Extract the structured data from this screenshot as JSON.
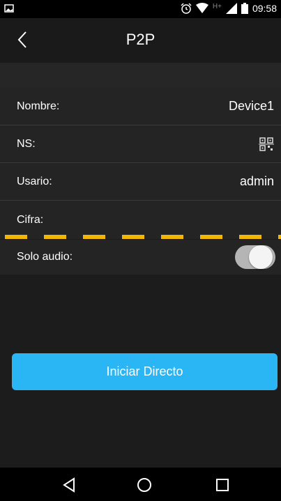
{
  "status": {
    "time": "09:58",
    "network": "H+"
  },
  "header": {
    "title": "P2P"
  },
  "form": {
    "name_label": "Nombre:",
    "name_value": "Device1",
    "ns_label": "NS:",
    "user_label": "Usario:",
    "user_value": "admin",
    "password_label": "Cifra:",
    "audio_label": "Solo audio:",
    "audio_only_enabled": false
  },
  "actions": {
    "start_label": "Iniciar Directo"
  },
  "colors": {
    "accent": "#2ab6f4",
    "dash": "#f2b705",
    "background": "#1c1c1c"
  }
}
